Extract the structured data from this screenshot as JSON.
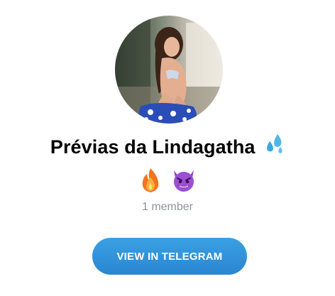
{
  "channel": {
    "title": "Prévias da Lindagatha",
    "title_emoji": "sweat-droplets-icon",
    "emojis": [
      "fire-icon",
      "smiling-devil-icon"
    ],
    "members": "1 member",
    "avatar": "channel-avatar-photo"
  },
  "cta": {
    "label": "VIEW IN TELEGRAM"
  },
  "colors": {
    "button": "#2e8fd8",
    "member_text": "#8f959b",
    "title_text": "#000000"
  }
}
